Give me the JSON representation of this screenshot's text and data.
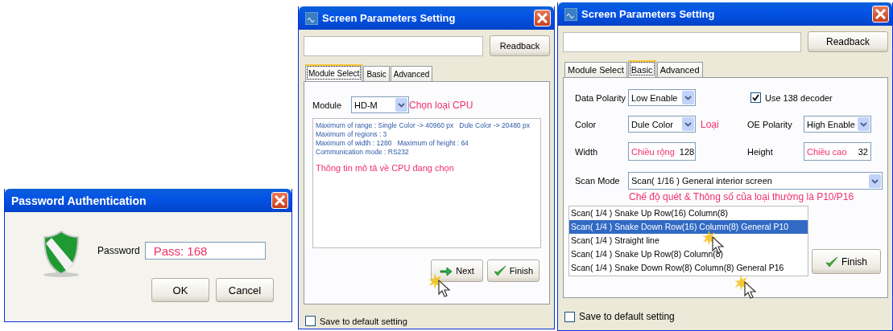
{
  "password_dialog": {
    "title": "Password Authentication",
    "label": "Password",
    "value": "Pass: 168",
    "buttons": [
      {
        "label": "OK"
      },
      {
        "label": "Cancel"
      }
    ]
  },
  "module_dialog": {
    "title": "Screen Parameters Setting",
    "readback": "Readback",
    "tabs": [
      {
        "label": "Module Select",
        "selected": true
      },
      {
        "label": "Basic",
        "selected": false
      },
      {
        "label": "Advanced",
        "selected": false
      }
    ],
    "module_label": "Module",
    "module_value": "HD-M",
    "module_note": "Chọn loại CPU",
    "info_lines": [
      [
        "Maximum of range : Single Color -> 40960 px",
        "Dule Color -> 20480 px"
      ],
      [
        "Maximum of regions : 3"
      ],
      [
        "Maximum of width : 1280",
        "Maximum of height : 64"
      ],
      [
        "Communication mode : RS232"
      ]
    ],
    "info_note": "Thông tin mô tả về CPU đang chọn",
    "buttons": [
      {
        "label": "Next",
        "kind": "next"
      },
      {
        "label": "Finish",
        "kind": "finish"
      }
    ],
    "save_default": {
      "label": "Save to default setting",
      "checked": false
    }
  },
  "basic_dialog": {
    "title": "Screen Parameters Setting",
    "readback": "Readback",
    "tabs": [
      {
        "label": "Module Select",
        "selected": false
      },
      {
        "label": "Basic",
        "selected": true
      },
      {
        "label": "Advanced",
        "selected": false
      }
    ],
    "fields": [
      {
        "kind": "select",
        "label": "Data Polarity",
        "value": "Low Enable"
      },
      {
        "kind": "checkbox",
        "label": "Use 138 decoder",
        "checked": true
      },
      {
        "kind": "select",
        "label": "Color",
        "value": "Dule Color",
        "note": "Loại"
      },
      {
        "kind": "select",
        "label": "OE Polarity",
        "value": "High Enable"
      },
      {
        "kind": "text",
        "label": "Width",
        "note": "Chiều rộng",
        "value": "128"
      },
      {
        "kind": "text",
        "label": "Height",
        "note": "Chiều cao",
        "value": "32"
      }
    ],
    "scan_label": "Scan Mode",
    "scan_value": "Scan( 1/16 ) General interior screen",
    "scan_note": "Chế độ quét & Thông số của loại thường là P10/P16",
    "scan_options": [
      {
        "label": "Scan( 1/4 ) Snake Up Row(16) Column(8)",
        "selected": false
      },
      {
        "label": "Scan( 1/4 ) Snake Down Row(16) Column(8) General P10",
        "selected": true
      },
      {
        "label": "Scan( 1/4 ) Straight line",
        "selected": false
      },
      {
        "label": "Scan( 1/4 ) Snake Up Row(8) Column(8)",
        "selected": false
      },
      {
        "label": "Scan( 1/4 ) Snake Down Row(8) Column(8) General P16",
        "selected": false
      }
    ],
    "finish": "Finish",
    "save_default": {
      "label": "Save to default setting",
      "checked": false
    }
  }
}
